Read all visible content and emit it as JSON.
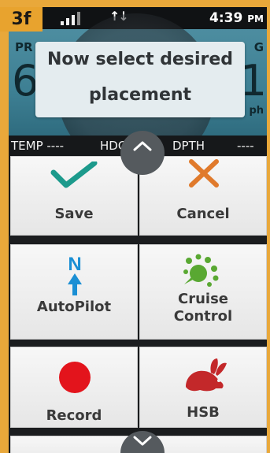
{
  "status": {
    "step_badge": "3f",
    "time": "4:39",
    "ampm": "PM"
  },
  "gauges": {
    "left_label": "PR",
    "left_value": "6",
    "right_label": "G",
    "right_value": "1",
    "right_unit": "ph"
  },
  "prompt": {
    "line1": "Now select desired",
    "line2": "placement"
  },
  "datastrip": {
    "temp": "TEMP ----",
    "hdg": "HDG 270°",
    "depth": "DPTH",
    "depth_value": "----"
  },
  "tiles": {
    "save": "Save",
    "cancel": "Cancel",
    "autopilot": "AutoPilot",
    "cruise_line1": "Cruise",
    "cruise_line2": "Control",
    "record": "Record",
    "hsb": "HSB"
  },
  "colors": {
    "accent": "#e8a32e",
    "save_check": "#1c9a8c",
    "cancel_x": "#e07a2c",
    "autopilot": "#1b8fd4",
    "cruise": "#59a832",
    "record": "#e3141c",
    "hsb": "#c3282a"
  }
}
